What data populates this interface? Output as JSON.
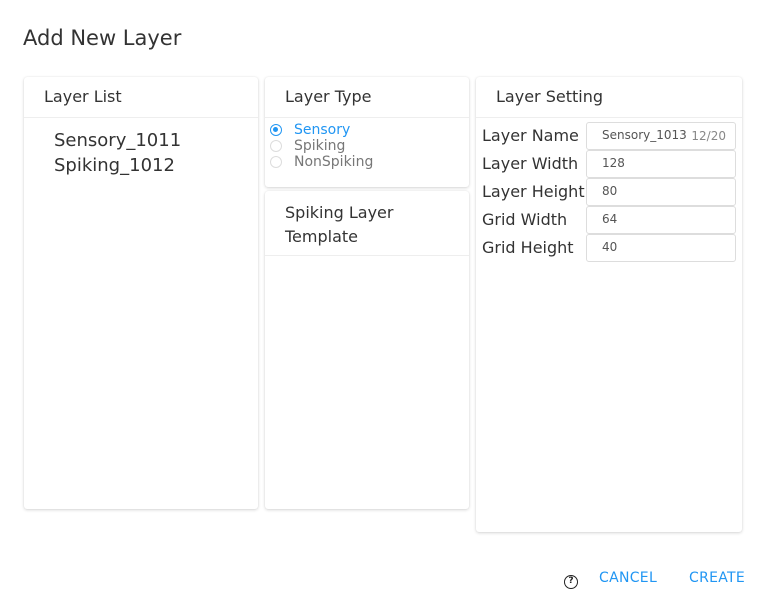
{
  "dialog": {
    "title": "Add New Layer"
  },
  "layer_list": {
    "header": "Layer List",
    "items": [
      "Sensory_1011",
      "Spiking_1012"
    ]
  },
  "layer_type": {
    "header": "Layer Type",
    "options": [
      {
        "label": "Sensory",
        "selected": true
      },
      {
        "label": "Spiking",
        "selected": false
      },
      {
        "label": "NonSpiking",
        "selected": false
      }
    ]
  },
  "template": {
    "header_line1": "Spiking Layer",
    "header_line2": "Template"
  },
  "layer_setting": {
    "header": "Layer Setting",
    "fields": [
      {
        "label": "Layer Name",
        "value": "Sensory_1013",
        "counter": "12/20"
      },
      {
        "label": "Layer Width",
        "value": "128"
      },
      {
        "label": "Layer Height",
        "value": "80"
      },
      {
        "label": "Grid Width",
        "value": "64"
      },
      {
        "label": "Grid Height",
        "value": "40"
      }
    ]
  },
  "footer": {
    "help_glyph": "?",
    "cancel_label": "CANCEL",
    "create_label": "CREATE"
  },
  "colors": {
    "accent": "#2196f3",
    "text": "#333333",
    "muted": "#777777"
  }
}
